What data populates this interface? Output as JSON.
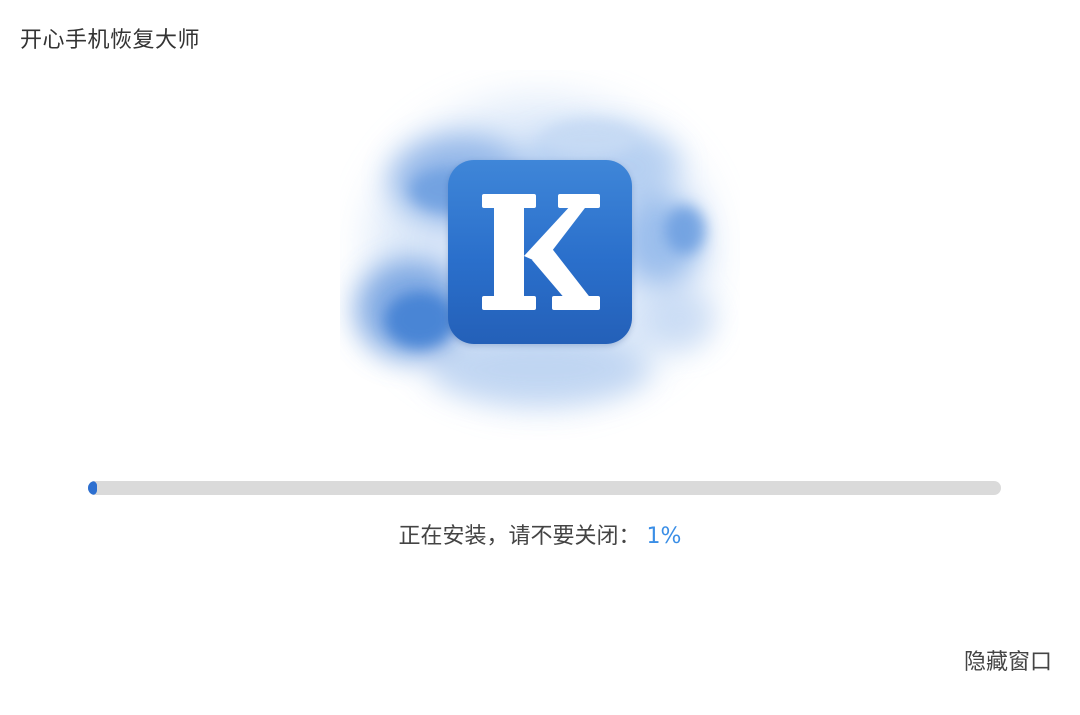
{
  "window": {
    "title": "开心手机恢复大师"
  },
  "logo": {
    "icon": "k-letter-icon",
    "letter": "K",
    "color": "#2d6fd0"
  },
  "install": {
    "progress_percent": 1,
    "status_text": "正在安装，请不要关闭：",
    "percent_label": "1%",
    "accent_color": "#3a8ee6"
  },
  "actions": {
    "hide_window_label": "隐藏窗口"
  }
}
